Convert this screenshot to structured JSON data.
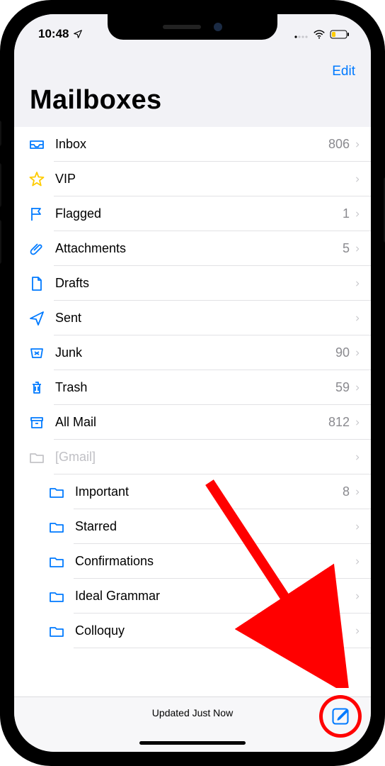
{
  "status_bar": {
    "time": "10:48",
    "location_icon": "location-arrow",
    "signal_icon": "cellular-bars",
    "wifi_icon": "wifi",
    "battery_icon": "battery-low"
  },
  "nav": {
    "edit_label": "Edit",
    "title": "Mailboxes"
  },
  "mailboxes": [
    {
      "icon": "inbox-icon",
      "label": "Inbox",
      "count": "806",
      "muted": false,
      "indent": false
    },
    {
      "icon": "star-icon",
      "label": "VIP",
      "count": "",
      "muted": false,
      "indent": false
    },
    {
      "icon": "flag-icon",
      "label": "Flagged",
      "count": "1",
      "muted": false,
      "indent": false
    },
    {
      "icon": "paperclip-icon",
      "label": "Attachments",
      "count": "5",
      "muted": false,
      "indent": false
    },
    {
      "icon": "draft-icon",
      "label": "Drafts",
      "count": "",
      "muted": false,
      "indent": false
    },
    {
      "icon": "sent-icon",
      "label": "Sent",
      "count": "",
      "muted": false,
      "indent": false
    },
    {
      "icon": "junk-icon",
      "label": "Junk",
      "count": "90",
      "muted": false,
      "indent": false
    },
    {
      "icon": "trash-icon",
      "label": "Trash",
      "count": "59",
      "muted": false,
      "indent": false
    },
    {
      "icon": "archive-icon",
      "label": "All Mail",
      "count": "812",
      "muted": false,
      "indent": false
    },
    {
      "icon": "folder-muted-icon",
      "label": "[Gmail]",
      "count": "",
      "muted": true,
      "indent": false
    },
    {
      "icon": "folder-icon",
      "label": "Important",
      "count": "8",
      "muted": false,
      "indent": true
    },
    {
      "icon": "folder-icon",
      "label": "Starred",
      "count": "",
      "muted": false,
      "indent": true
    },
    {
      "icon": "folder-icon",
      "label": "Confirmations",
      "count": "",
      "muted": false,
      "indent": true
    },
    {
      "icon": "folder-icon",
      "label": "Ideal Grammar",
      "count": "",
      "muted": false,
      "indent": true
    },
    {
      "icon": "folder-icon",
      "label": "Colloquy",
      "count": "",
      "muted": false,
      "indent": true
    }
  ],
  "toolbar": {
    "status_text": "Updated Just Now",
    "compose_label": "Compose"
  },
  "annotation": {
    "highlight_target": "compose-button"
  },
  "colors": {
    "accent": "#007aff",
    "muted": "#8a8a8f",
    "star": "#ffcc00",
    "annotation": "#ff0000"
  }
}
